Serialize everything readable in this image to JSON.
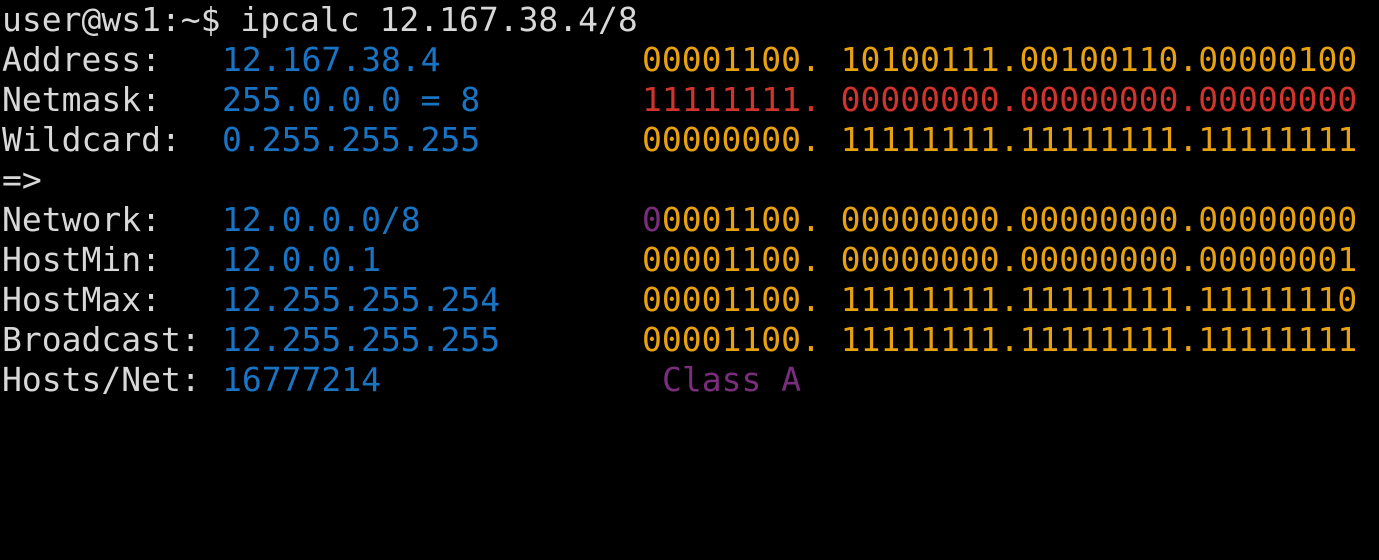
{
  "terminal": {
    "prompt": "user@ws1:~$ ",
    "command": "ipcalc 12.167.38.4/8",
    "separator": "=>",
    "colors": {
      "background": "#000000",
      "text": "#d8d8d8",
      "value": "#1a74c4",
      "binary": "#e8a20e",
      "netmask_bits": "#d0342c",
      "class": "#7a2d7d"
    },
    "input_rows": [
      {
        "label": "Address:",
        "value": "12.167.38.4",
        "bin_prefix": "",
        "bin_main": "00001100. 10100111.00100110.00000100"
      },
      {
        "label": "Netmask:",
        "value": "255.0.0.0 = 8",
        "bin_red_a": "11111111.",
        "bin_red_b": " 00000000.00000000.00000000"
      },
      {
        "label": "Wildcard:",
        "value": "0.255.255.255",
        "bin_prefix": "",
        "bin_main": "00000000. 11111111.11111111.11111111"
      }
    ],
    "output_rows": [
      {
        "label": "Network:",
        "value": "12.0.0.0/8",
        "bin_prefix": "0",
        "bin_main": "0001100. 00000000.00000000.00000000"
      },
      {
        "label": "HostMin:",
        "value": "12.0.0.1",
        "bin_prefix": "",
        "bin_main": "00001100. 00000000.00000000.00000001"
      },
      {
        "label": "HostMax:",
        "value": "12.255.255.254",
        "bin_prefix": "",
        "bin_main": "00001100. 11111111.11111111.11111110"
      },
      {
        "label": "Broadcast:",
        "value": "12.255.255.255",
        "bin_prefix": "",
        "bin_main": "00001100. 11111111.11111111.11111111"
      }
    ],
    "hosts": {
      "label": "Hosts/Net:",
      "value": "16777214",
      "class": "Class A"
    }
  }
}
